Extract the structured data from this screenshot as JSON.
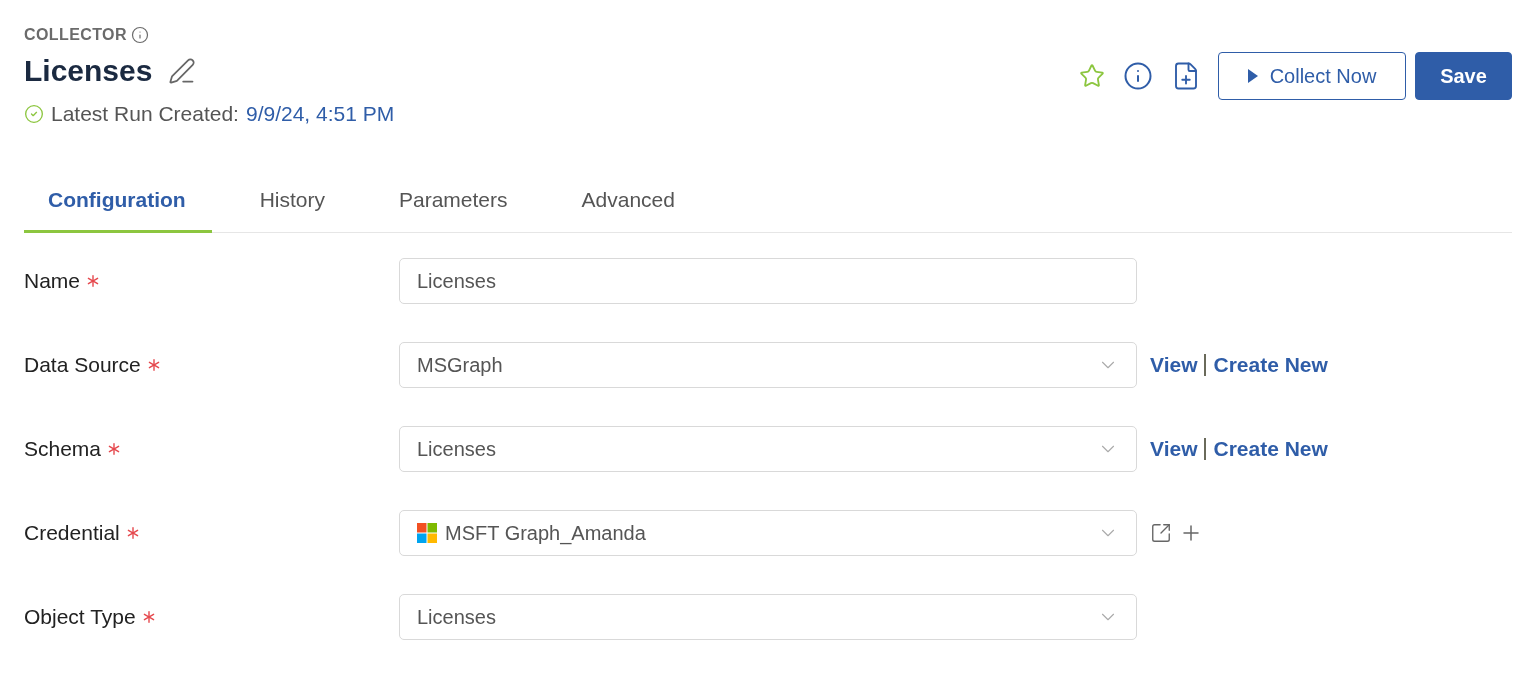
{
  "header": {
    "eyebrow": "COLLECTOR",
    "title": "Licenses",
    "status": {
      "label": "Latest Run Created:",
      "value": "9/9/24, 4:51 PM"
    }
  },
  "toolbar": {
    "favorite": false,
    "buttons": [
      {
        "label": "Collect Now",
        "kind": "run"
      },
      {
        "label": "Save",
        "kind": "primary"
      }
    ]
  },
  "tabs": [
    {
      "label": "Configuration",
      "selected": true
    },
    {
      "label": "History",
      "selected": false
    },
    {
      "label": "Parameters",
      "selected": false
    },
    {
      "label": "Advanced",
      "selected": false
    }
  ],
  "form": {
    "fields": [
      {
        "label": "Name",
        "required": true,
        "kind": "text",
        "value": "Licenses"
      },
      {
        "label": "Data Source",
        "required": true,
        "kind": "select",
        "value": "MSGraph",
        "trailing": {
          "kind": "links",
          "links": [
            "View",
            "Create New"
          ]
        }
      },
      {
        "label": "Schema",
        "required": true,
        "kind": "select",
        "value": "Licenses",
        "trailing": {
          "kind": "links",
          "links": [
            "View",
            "Create New"
          ]
        }
      },
      {
        "label": "Credential",
        "required": true,
        "kind": "account_select",
        "value": "MSFT Graph_Amanda",
        "trailing": {
          "kind": "icon_buttons"
        }
      },
      {
        "label": "Object Type",
        "required": true,
        "kind": "select",
        "value": "Licenses"
      }
    ]
  }
}
